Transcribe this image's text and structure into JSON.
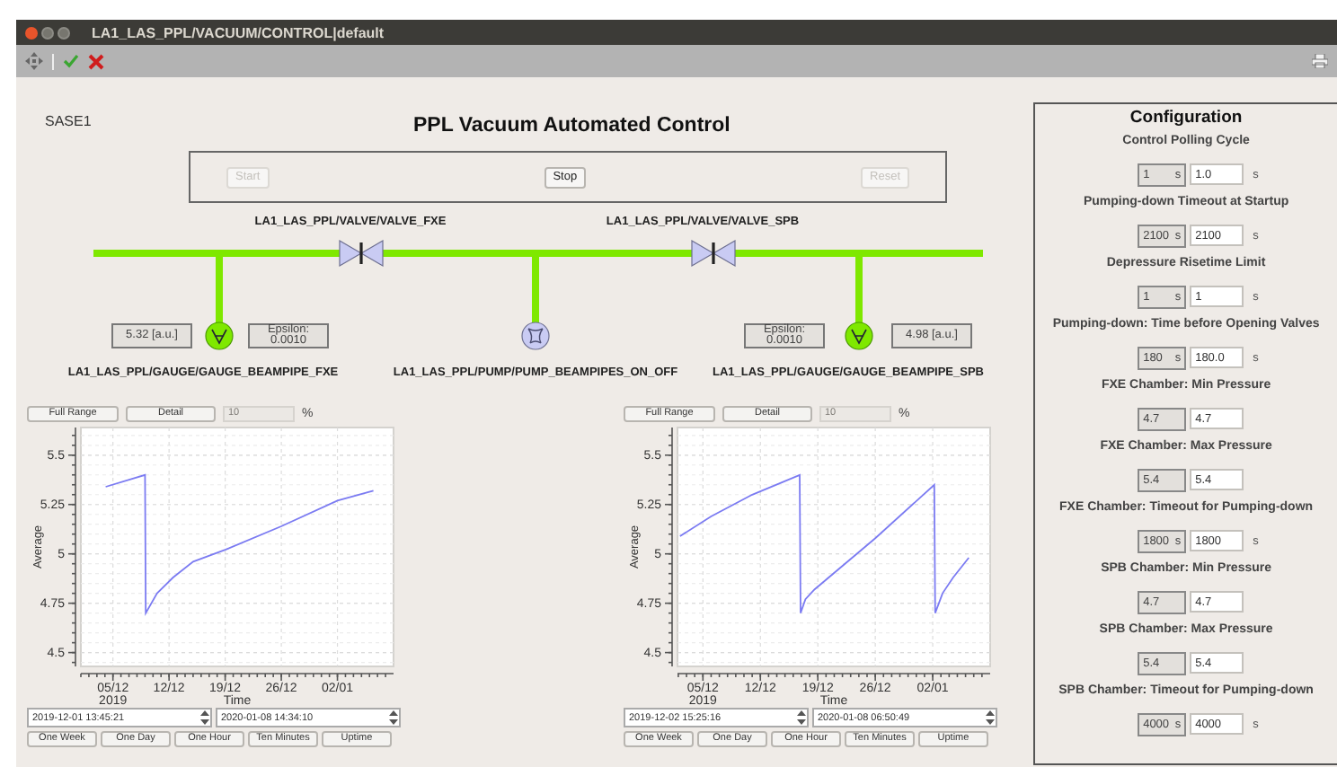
{
  "window": {
    "title": "LA1_LAS_PPL/VACUUM/CONTROL|default"
  },
  "header": {
    "facility": "SASE1",
    "title": "PPL Vacuum Automated Control"
  },
  "controls": [
    {
      "label": "Start",
      "disabled": true
    },
    {
      "label": "Stop",
      "disabled": false
    },
    {
      "label": "Reset",
      "disabled": true
    }
  ],
  "diagram": {
    "valves": [
      {
        "name": "LA1_LAS_PPL/VALVE/VALVE_FXE"
      },
      {
        "name": "LA1_LAS_PPL/VALVE/VALVE_SPB"
      }
    ],
    "gauges": [
      {
        "name": "LA1_LAS_PPL/GAUGE/GAUGE_BEAMPIPE_FXE",
        "reading": "5.32 [a.u.]",
        "epsilon_label": "Epsilon:",
        "epsilon": "0.0010"
      },
      {
        "name": "LA1_LAS_PPL/GAUGE/GAUGE_BEAMPIPE_SPB",
        "reading": "4.98 [a.u.]",
        "epsilon_label": "Epsilon:",
        "epsilon": "0.0010"
      }
    ],
    "pump": {
      "name": "LA1_LAS_PPL/PUMP/PUMP_BEAMPIPES_ON_OFF"
    }
  },
  "charts": [
    {
      "full_range": "Full Range",
      "detail": "Detail",
      "percent": {
        "value": "10",
        "disabled": true
      },
      "percent_sign": "%",
      "chart_data": {
        "type": "line",
        "xlabel": "Time",
        "ylabel": "Average",
        "x": [
          "2019-12-04T02:24",
          "2019-12-09T00:00",
          "2019-12-09T02:24",
          "2019-12-10T12:00",
          "2019-12-12T12:00",
          "2019-12-15T00:00",
          "2019-12-19T00:00",
          "2019-12-26T00:00",
          "2020-01-02T00:00",
          "2020-01-06T12:00"
        ],
        "grid": true,
        "series": [
          {
            "color": "#7b7bf2",
            "values": [
              5.34,
              5.4,
              4.7,
              4.8,
              4.88,
              4.96,
              5.02,
              5.14,
              5.27,
              5.32
            ]
          }
        ],
        "xlim": [
          "2019-12-01T00:00",
          "2020-01-09T00:00"
        ],
        "ylim": [
          4.43,
          5.64
        ],
        "xticks": [
          {
            "value": "2019-12-05",
            "label": "05/12\n2019"
          },
          {
            "value": "2019-12-12",
            "label": "12/12"
          },
          {
            "value": "2019-12-19",
            "label": "19/12"
          },
          {
            "value": "2019-12-26",
            "label": "26/12"
          },
          {
            "value": "2020-01-02",
            "label": "02/01"
          }
        ],
        "yticks": [
          4.5,
          4.75,
          5,
          5.25,
          5.5
        ]
      },
      "start": "2019-12-01 13:45:21",
      "end": "2020-01-08 14:34:10",
      "presets": [
        "One Week",
        "One Day",
        "One Hour",
        "Ten Minutes",
        "Uptime"
      ]
    },
    {
      "full_range": "Full Range",
      "detail": "Detail",
      "percent": {
        "value": "10",
        "disabled": true
      },
      "percent_sign": "%",
      "chart_data": {
        "type": "line",
        "xlabel": "Time",
        "ylabel": "Average",
        "x": [
          "2019-12-02T04:48",
          "2019-12-06T00:00",
          "2019-12-11T00:00",
          "2019-12-16T19:12",
          "2019-12-16T21:36",
          "2019-12-17T12:00",
          "2019-12-18T14:24",
          "2019-12-26T00:00",
          "2020-01-02T04:48",
          "2020-01-02T07:12",
          "2020-01-03T04:48",
          "2020-01-04T12:00",
          "2020-01-06T09:36"
        ],
        "grid": true,
        "series": [
          {
            "color": "#7b7bf2",
            "values": [
              5.09,
              5.19,
              5.3,
              5.4,
              4.7,
              4.77,
              4.82,
              5.08,
              5.35,
              4.7,
              4.8,
              4.88,
              4.98
            ]
          }
        ],
        "xlim": [
          "2019-12-01T21:36",
          "2020-01-09T00:00"
        ],
        "ylim": [
          4.43,
          5.64
        ],
        "xticks": [
          {
            "value": "2019-12-05",
            "label": "05/12\n2019"
          },
          {
            "value": "2019-12-12",
            "label": "12/12"
          },
          {
            "value": "2019-12-19",
            "label": "19/12"
          },
          {
            "value": "2019-12-26",
            "label": "26/12"
          },
          {
            "value": "2020-01-02",
            "label": "02/01"
          }
        ],
        "yticks": [
          4.5,
          4.75,
          5,
          5.25,
          5.5
        ]
      },
      "start": "2019-12-02 15:25:16",
      "end": "2020-01-08 06:50:49",
      "presets": [
        "One Week",
        "One Day",
        "One Hour",
        "Ten Minutes",
        "Uptime"
      ]
    }
  ],
  "configuration": {
    "title": "Configuration",
    "items": [
      {
        "label": "Control Polling Cycle",
        "readback": "1",
        "readback_unit": "s",
        "value": "1.0",
        "unit": "s"
      },
      {
        "label": "Pumping-down Timeout at Startup",
        "readback": "2100",
        "readback_unit": "s",
        "value": "2100",
        "unit": "s"
      },
      {
        "label": "Depressure Risetime Limit",
        "readback": "1",
        "readback_unit": "s",
        "value": "1",
        "unit": "s"
      },
      {
        "label": "Pumping-down: Time before Opening Valves",
        "readback": "180",
        "readback_unit": "s",
        "value": "180.0",
        "unit": "s"
      },
      {
        "label": "FXE Chamber: Min Pressure",
        "readback": "4.7",
        "value": "4.7"
      },
      {
        "label": "FXE Chamber: Max Pressure",
        "readback": "5.4",
        "value": "5.4"
      },
      {
        "label": "FXE Chamber: Timeout for Pumping-down",
        "readback": "1800",
        "readback_unit": "s",
        "value": "1800",
        "unit": "s"
      },
      {
        "label": "SPB Chamber: Min Pressure",
        "readback": "4.7",
        "value": "4.7"
      },
      {
        "label": "SPB Chamber: Max Pressure",
        "readback": "5.4",
        "value": "5.4"
      },
      {
        "label": "SPB Chamber: Timeout for Pumping-down",
        "readback": "4000",
        "readback_unit": "s",
        "value": "4000",
        "unit": "s"
      }
    ]
  }
}
